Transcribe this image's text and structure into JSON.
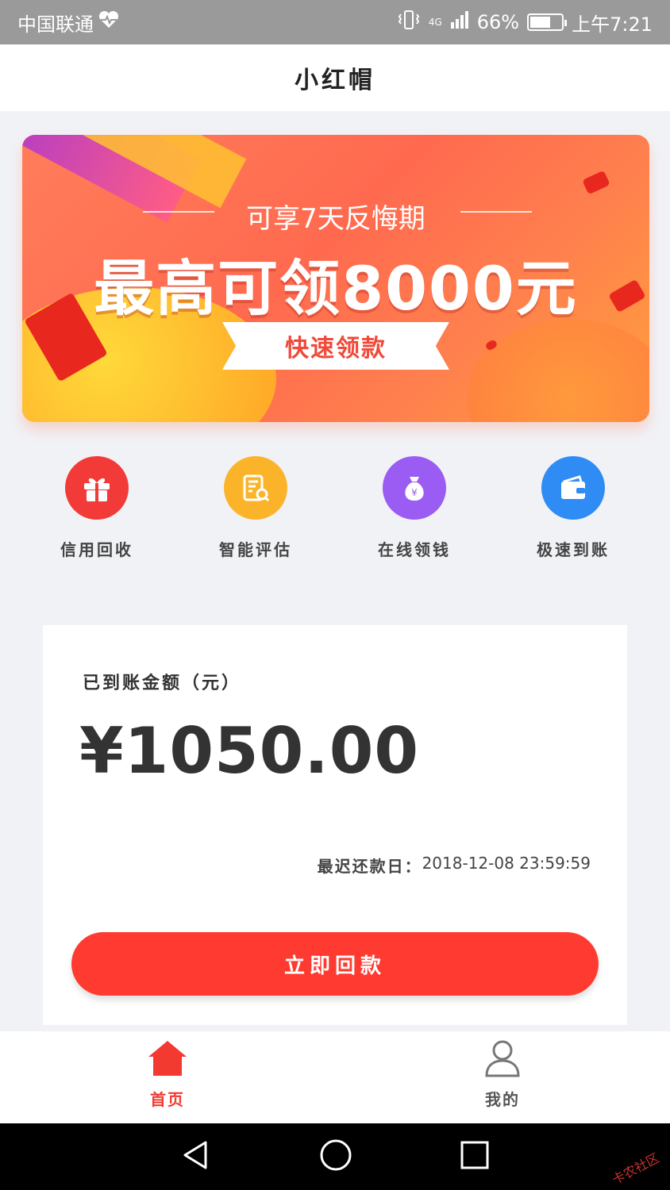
{
  "status_bar": {
    "carrier": "中国联通",
    "network": "4G",
    "battery": "66%",
    "battery_level": 0.66,
    "time": "上午7:21"
  },
  "header": {
    "title": "小红帽"
  },
  "banner": {
    "subtitle": "可享7天反悔期",
    "headline": "最高可领8000元",
    "cta": "快速领款"
  },
  "quick_menu": [
    {
      "label": "信用回收",
      "icon": "gift-icon",
      "color": "#f23a38"
    },
    {
      "label": "智能评估",
      "icon": "document-search-icon",
      "color": "#fbb42a"
    },
    {
      "label": "在线领钱",
      "icon": "money-bag-icon",
      "color": "#9b5cf3"
    },
    {
      "label": "极速到账",
      "icon": "wallet-icon",
      "color": "#2f8cf5"
    }
  ],
  "account_card": {
    "caption": "已到账金额（元）",
    "amount": "¥1050.00",
    "due_label": "最迟还款日：",
    "due_value": "2018-12-08 23:59:59",
    "repay_button": "立即回款"
  },
  "tab_bar": [
    {
      "label": "首页",
      "icon": "home-icon",
      "active": true,
      "color": "#f23a30"
    },
    {
      "label": "我的",
      "icon": "user-icon",
      "active": false,
      "color": "#555555"
    }
  ],
  "nav_bar": {
    "buttons": [
      "back-icon",
      "home-circle-icon",
      "recents-icon"
    ]
  },
  "watermark": "卡农社区"
}
